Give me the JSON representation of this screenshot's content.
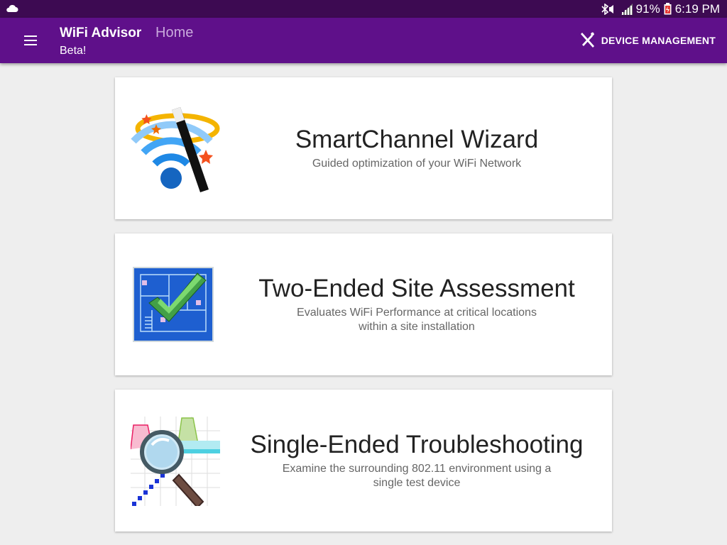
{
  "status_bar": {
    "battery": "91%",
    "time": "6:19 PM",
    "icons": [
      "cloud-icon",
      "bluetooth-mute-icon",
      "signal-icon",
      "battery-icon"
    ]
  },
  "app_bar": {
    "title": "WiFi Advisor",
    "subtitle": "Beta!",
    "nav_label": "Home",
    "action_label": "DEVICE MANAGEMENT",
    "background": "#5f108a",
    "status_background": "#3d0a52"
  },
  "cards": [
    {
      "title": "SmartChannel Wizard",
      "description": "Guided optimization of your WiFi Network",
      "icon": "wifi-wand-icon"
    },
    {
      "title": "Two-Ended Site Assessment",
      "description": "Evaluates WiFi Performance at critical locations\nwithin a site installation",
      "icon": "floorplan-check-icon"
    },
    {
      "title": "Single-Ended Troubleshooting",
      "description": "Examine the surrounding 802.11 environment using a\nsingle test device",
      "icon": "spectrum-magnifier-icon"
    }
  ]
}
